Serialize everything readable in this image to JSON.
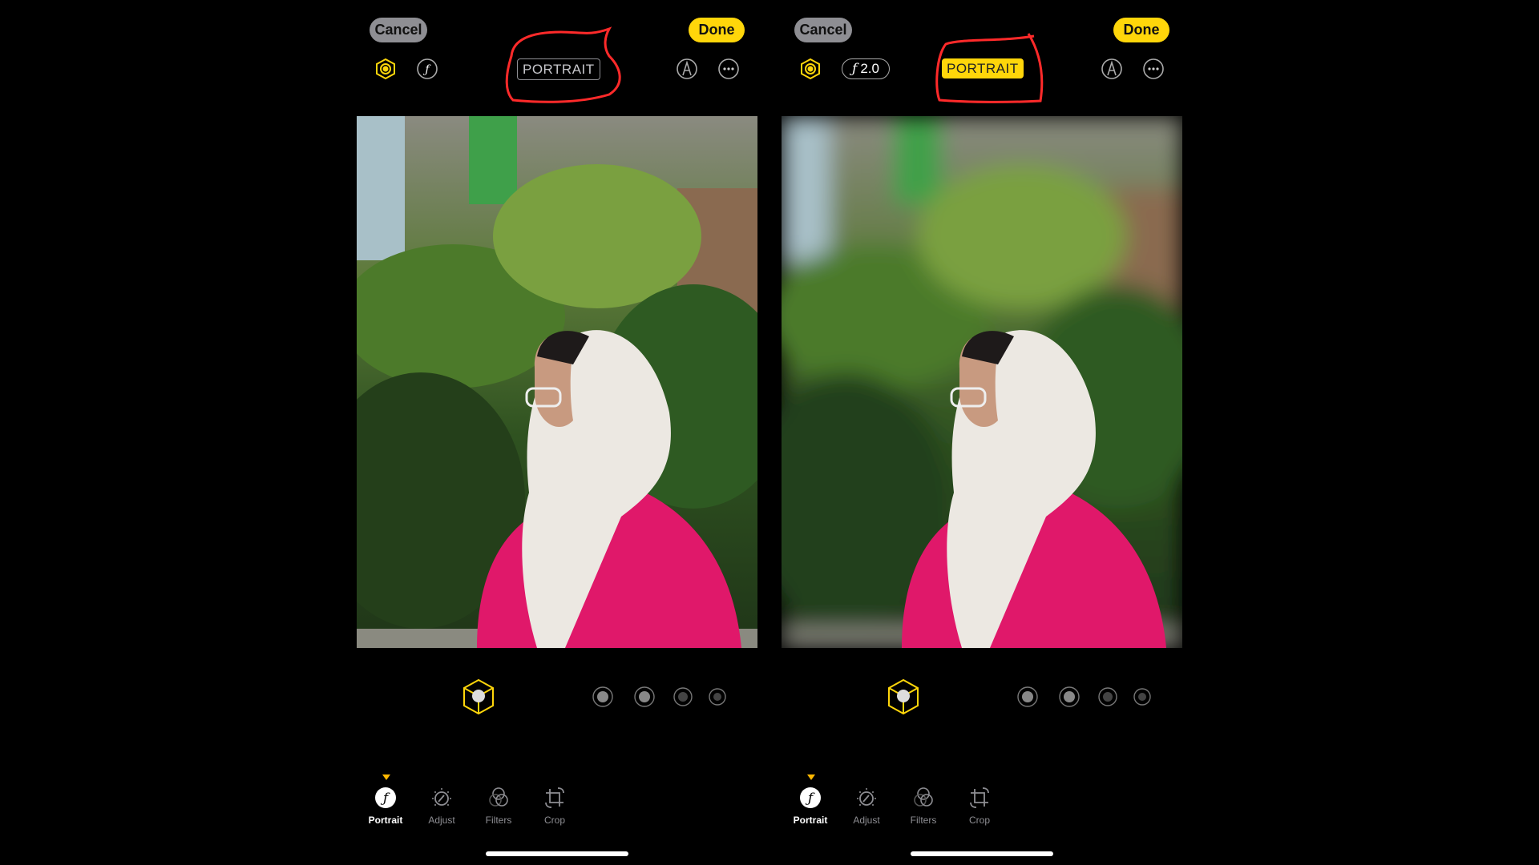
{
  "panels": [
    {
      "id": "left",
      "cancel": "Cancel",
      "done": "Done",
      "mode_badge": "PORTRAIT",
      "mode_badge_active": false,
      "aperture_label": "",
      "blurred": false,
      "tabs": [
        {
          "label": "Portrait",
          "icon": "portrait-f-icon"
        },
        {
          "label": "Adjust",
          "icon": "adjust-dial-icon"
        },
        {
          "label": "Filters",
          "icon": "filters-circles-icon"
        },
        {
          "label": "Crop",
          "icon": "crop-rotate-icon"
        }
      ]
    },
    {
      "id": "right",
      "cancel": "Cancel",
      "done": "Done",
      "mode_badge": "PORTRAIT",
      "mode_badge_active": true,
      "aperture_label": "2.0",
      "blurred": true,
      "tabs": [
        {
          "label": "Portrait",
          "icon": "portrait-f-icon"
        },
        {
          "label": "Adjust",
          "icon": "adjust-dial-icon"
        },
        {
          "label": "Filters",
          "icon": "filters-circles-icon"
        },
        {
          "label": "Crop",
          "icon": "crop-rotate-icon"
        }
      ]
    }
  ],
  "lighting_options": [
    "natural-light",
    "studio-light",
    "contour-light",
    "stage-light",
    "stage-light-mono"
  ],
  "selected_tab": "Portrait",
  "colors": {
    "accent": "#ffd60a",
    "annotation": "#ff2a2a",
    "cancel_bg": "#8e8e93"
  }
}
